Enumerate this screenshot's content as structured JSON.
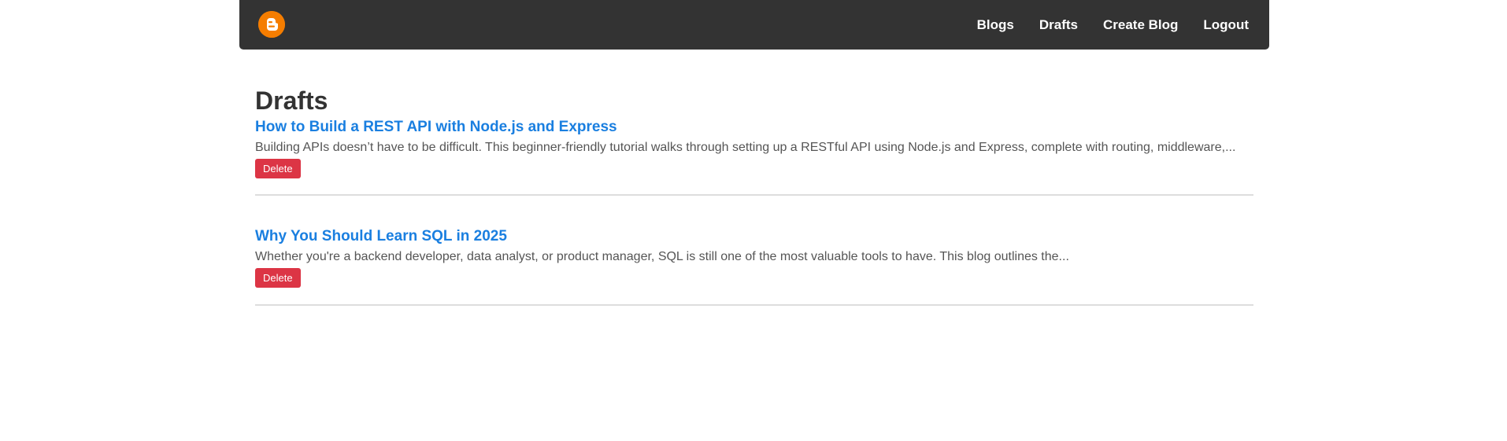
{
  "nav": {
    "logo": "blogger-logo-icon",
    "links": [
      "Blogs",
      "Drafts",
      "Create Blog",
      "Logout"
    ],
    "brand_color": "#f57d00",
    "bar_color": "#333333"
  },
  "page": {
    "title": "Drafts"
  },
  "drafts": [
    {
      "title": "How to Build a REST API with Node.js and Express",
      "excerpt": "Building APIs doesn’t have to be difficult. This beginner-friendly tutorial walks through setting up a RESTful API using Node.js and Express, complete with routing, middleware,...",
      "delete_label": "Delete"
    },
    {
      "title": "Why You Should Learn SQL in 2025",
      "excerpt": "Whether you're a backend developer, data analyst, or product manager, SQL is still one of the most valuable tools to have. This blog outlines the...",
      "delete_label": "Delete"
    }
  ],
  "colors": {
    "link": "#1a7fe0",
    "delete": "#dc3545"
  }
}
